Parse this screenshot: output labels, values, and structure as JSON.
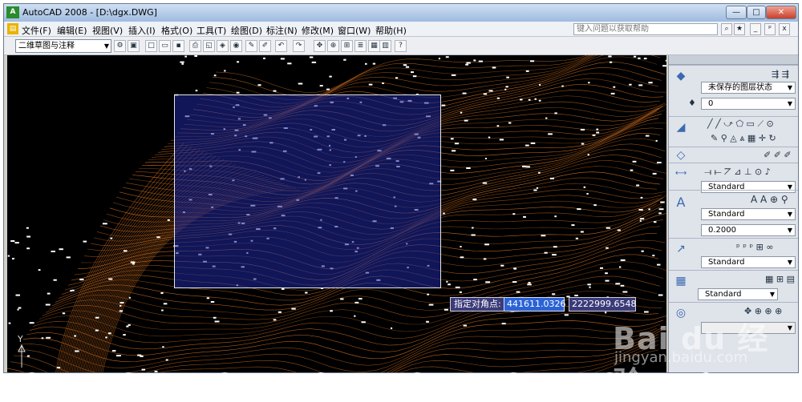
{
  "window": {
    "title": "AutoCAD 2008 - [D:\\dgx.DWG]",
    "app_icon": "autocad-logo",
    "controls": [
      "—",
      "□",
      "✕"
    ]
  },
  "menu": {
    "items": [
      "文件(F)",
      "编辑(E)",
      "视图(V)",
      "插入(I)",
      "格式(O)",
      "工具(T)",
      "绘图(D)",
      "标注(N)",
      "修改(M)",
      "窗口(W)",
      "帮助(H)"
    ],
    "help_placeholder": "键入问题以获取帮助",
    "doc_controls": [
      "_",
      "ᵖ",
      "x"
    ]
  },
  "toolbar": {
    "workspace": "二维草图与注释"
  },
  "canvas": {
    "background": "#000000",
    "contour_color": "#c86a1e",
    "selection_fill": "#1e28a0",
    "prompt_label": "指定对角点:",
    "coord_x": "441611.0326",
    "coord_y": "2222999.6548",
    "ucs_y_label": "Y"
  },
  "palette": {
    "layer_state": "未保存的图层状态",
    "layer_current": "0",
    "dim_style": "Standard",
    "text_style": "Standard",
    "text_height": "0.2000",
    "mleader_style": "Standard",
    "table_style": "Standard"
  },
  "watermark": {
    "logo": "Bai du 经验",
    "url": "jingyan.baidu.com"
  }
}
